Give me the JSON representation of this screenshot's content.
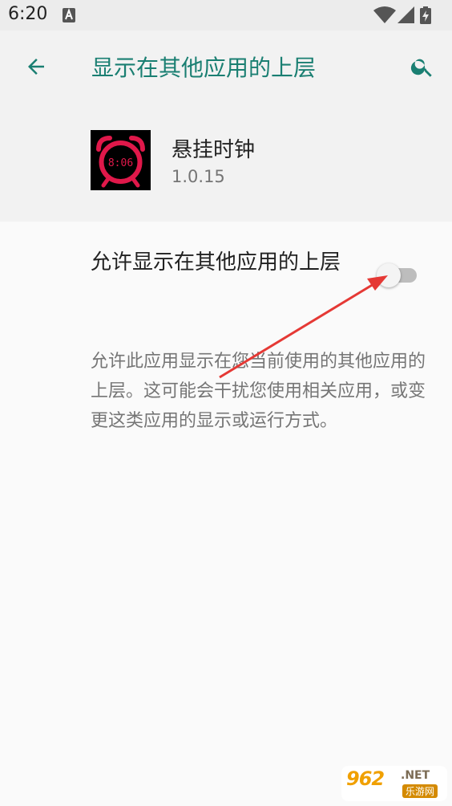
{
  "status_bar": {
    "time": "6:20",
    "icons": [
      "text-a-icon",
      "wifi-icon",
      "signal-icon",
      "battery-charging-icon"
    ]
  },
  "toolbar": {
    "title": "显示在其他应用的上层",
    "back_icon": "arrow-left-icon",
    "search_icon": "search-icon",
    "accent_color": "#1a7f72"
  },
  "app": {
    "name": "悬挂时钟",
    "version": "1.0.15",
    "icon_text": "8:06",
    "icon_color": "#e0184a"
  },
  "setting": {
    "label": "允许显示在其他应用的上层",
    "enabled": false
  },
  "description": "允许此应用显示在您当前使用的其他应用的上层。这可能会干扰您使用相关应用，或变更这类应用的显示或运行方式。",
  "watermark": {
    "logo": "962",
    "suffix": ".NET",
    "site": "乐游网"
  }
}
